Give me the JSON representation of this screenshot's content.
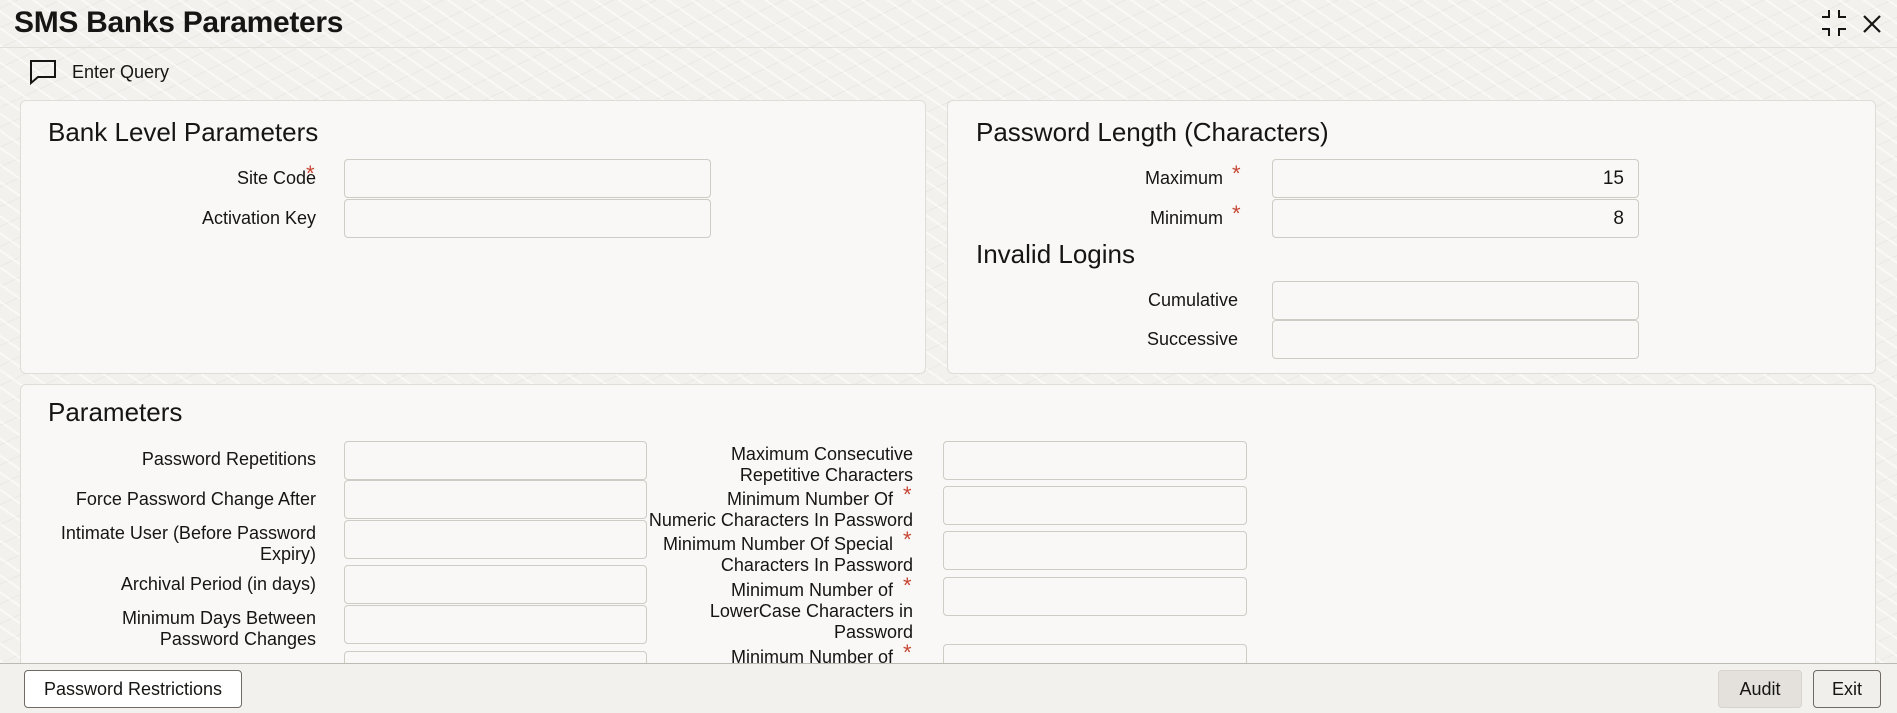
{
  "window": {
    "title": "SMS Banks Parameters",
    "icons": [
      "maximize-icon",
      "close-icon"
    ]
  },
  "toolbar": {
    "enter_query_label": "Enter Query",
    "icon": "comment-icon"
  },
  "bank_level": {
    "title": "Bank Level Parameters",
    "site_code_label": "Site Code",
    "site_code_value": "",
    "activation_key_label": "Activation Key",
    "activation_key_value": ""
  },
  "password_length": {
    "title": "Password Length (Characters)",
    "maximum_label": "Maximum",
    "maximum_value": "15",
    "minimum_label": "Minimum",
    "minimum_value": "8"
  },
  "invalid_logins": {
    "title": "Invalid Logins",
    "cumulative_label": "Cumulative",
    "cumulative_value": "",
    "successive_label": "Successive",
    "successive_value": ""
  },
  "parameters": {
    "title": "Parameters",
    "left": {
      "password_repetitions": "Password Repetitions",
      "force_change_after": "Force Password Change After",
      "intimate_user_l1": "Intimate User (Before Password",
      "intimate_user_l2": "Expiry)",
      "archival_period": "Archival Period (in days)",
      "min_days_l1": "Minimum Days Between",
      "min_days_l2": "Password Changes"
    },
    "right": {
      "max_consec_l1": "Maximum Consecutive",
      "max_consec_l2": "Repetitive Characters",
      "min_numeric_l1": "Minimum Number Of",
      "min_numeric_l2": "Numeric Characters In Password",
      "min_special_l1": "Minimum Number Of Special",
      "min_special_l2": "Characters In Password",
      "min_lower_l1": "Minimum Number of",
      "min_lower_l2": "LowerCase Characters in",
      "min_lower_l3": "Password",
      "min_upper_l1": "Minimum Number of"
    }
  },
  "footer": {
    "password_restrictions": "Password Restrictions",
    "audit": "Audit",
    "exit": "Exit"
  },
  "colors": {
    "required": "#c74634",
    "panel": "#f9f8f6",
    "background": "#f3f1ee"
  }
}
